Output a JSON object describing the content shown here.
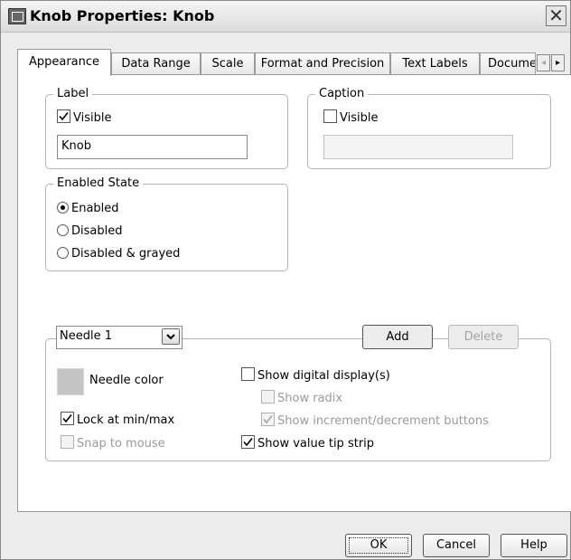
{
  "window": {
    "title": "Knob Properties: Knob",
    "close_glyph": "✕"
  },
  "tabs": [
    {
      "label": "Appearance",
      "active": true
    },
    {
      "label": "Data Range"
    },
    {
      "label": "Scale"
    },
    {
      "label": "Format and Precision"
    },
    {
      "label": "Text Labels"
    },
    {
      "label": "Docume"
    }
  ],
  "tab_scroll": {
    "left_glyph": "◂",
    "right_glyph": "▸"
  },
  "label_group": {
    "legend": "Label",
    "visible_label": "Visible",
    "visible_checked": true,
    "value": "Knob"
  },
  "caption_group": {
    "legend": "Caption",
    "visible_label": "Visible",
    "visible_checked": false,
    "value": ""
  },
  "enabled_state": {
    "legend": "Enabled State",
    "options": [
      "Enabled",
      "Disabled",
      "Disabled & grayed"
    ],
    "selected": "Enabled"
  },
  "needle": {
    "select_value": "Needle 1",
    "add_label": "Add",
    "delete_label": "Delete",
    "color_label": "Needle color",
    "color": "#c4c4c4",
    "lock_label": "Lock at min/max",
    "lock_checked": true,
    "snap_label": "Snap to mouse",
    "snap_checked": false,
    "digital_label": "Show digital display(s)",
    "digital_checked": false,
    "radix_label": "Show radix",
    "radix_checked": false,
    "incdec_label": "Show increment/decrement buttons",
    "incdec_checked": true,
    "tipstrip_label": "Show value tip strip",
    "tipstrip_checked": true
  },
  "footer": {
    "ok_label": "OK",
    "cancel_label": "Cancel",
    "help_label": "Help"
  }
}
